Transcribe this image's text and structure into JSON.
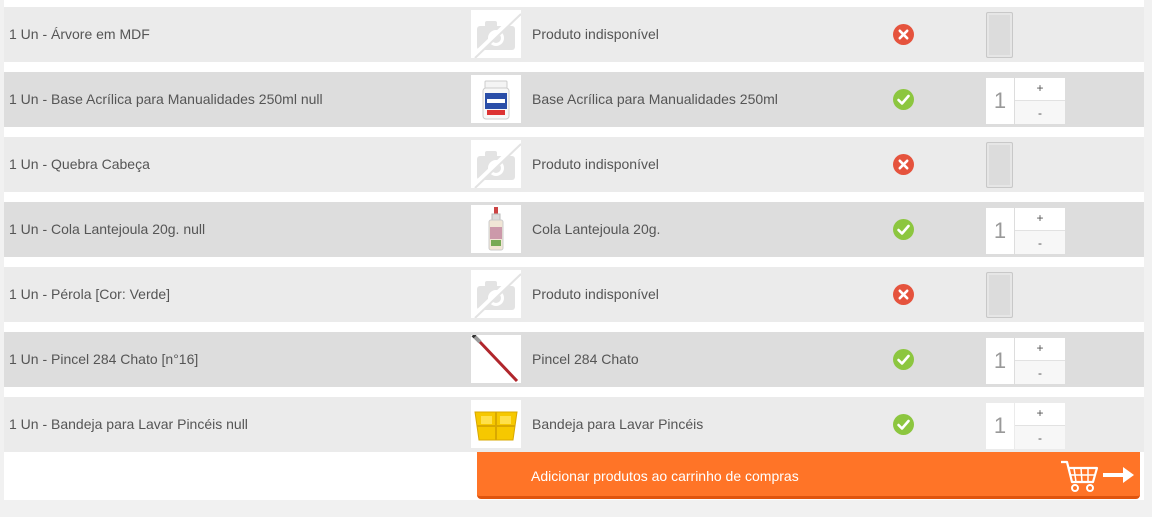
{
  "rows": [
    {
      "request": "1 Un - Árvore em MDF",
      "product": "Produto indisponível",
      "available": false,
      "thumb": "no-photo-icon"
    },
    {
      "request": "1 Un - Base Acrílica para Manualidades 250ml null",
      "product": "Base Acrílica para Manualidades 250ml",
      "available": true,
      "qty": "1",
      "thumb": "acrylic-base-jar"
    },
    {
      "request": "1 Un - Quebra Cabeça",
      "product": "Produto indisponível",
      "available": false,
      "thumb": "no-photo-icon"
    },
    {
      "request": "1 Un - Cola Lantejoula 20g. null",
      "product": "Cola Lantejoula 20g.",
      "available": true,
      "qty": "1",
      "thumb": "glue-bottle"
    },
    {
      "request": "1 Un - Pérola [Cor: Verde]",
      "product": "Produto indisponível",
      "available": false,
      "thumb": "no-photo-icon"
    },
    {
      "request": "1 Un - Pincel 284 Chato [n°16]",
      "product": "Pincel 284 Chato",
      "available": true,
      "qty": "1",
      "thumb": "paint-brush"
    },
    {
      "request": "1 Un - Bandeja para Lavar Pincéis null",
      "product": "Bandeja para Lavar Pincéis",
      "available": true,
      "qty": "1",
      "thumb": "yellow-tray"
    }
  ],
  "stepper": {
    "plus": "+",
    "minus": "-"
  },
  "cart_button": {
    "label": "Adicionar produtos ao carrinho de compras",
    "icon": "shopping-cart-arrow-icon"
  },
  "colors": {
    "accent": "#ff7427",
    "available": "#8cc63f",
    "unavailable": "#e5533d"
  }
}
